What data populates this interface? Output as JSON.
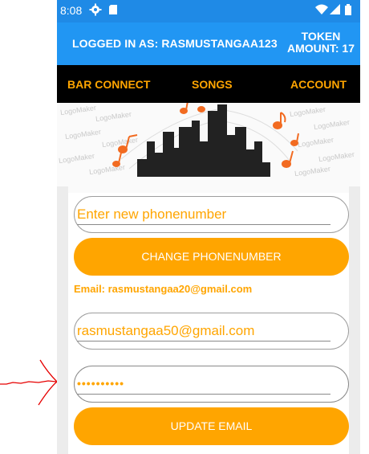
{
  "status": {
    "time": "8:08",
    "left_icons": [
      "gear-icon",
      "sd-card-icon"
    ],
    "right_icons": [
      "wifi-icon",
      "signal-icon",
      "battery-icon"
    ]
  },
  "header": {
    "logged_in": "LOGGED IN AS:  RASMUSTANGAA123",
    "token_line1": "TOKEN",
    "token_line2": "AMOUNT:  17"
  },
  "nav": {
    "bar_connect": "BAR CONNECT",
    "songs": "SONGS",
    "account": "ACCOUNT"
  },
  "banner": {
    "watermark": "LogoMaker"
  },
  "phone_form": {
    "phone_placeholder": "Enter new phonenumber",
    "change_phone_label": "CHANGE PHONENUMBER"
  },
  "email_form": {
    "current_email": "Email: rasmustangaa20@gmail.com",
    "new_email_value": "rasmustangaa50@gmail.com",
    "password_masked": "••••••••••",
    "update_email_label": "UPDATE EMAIL"
  },
  "colors": {
    "status_bar": "#1f8ae6",
    "app_bar": "#2196f3",
    "nav_bar": "#000000",
    "accent": "#ffa500",
    "annotation": "#e60000"
  }
}
